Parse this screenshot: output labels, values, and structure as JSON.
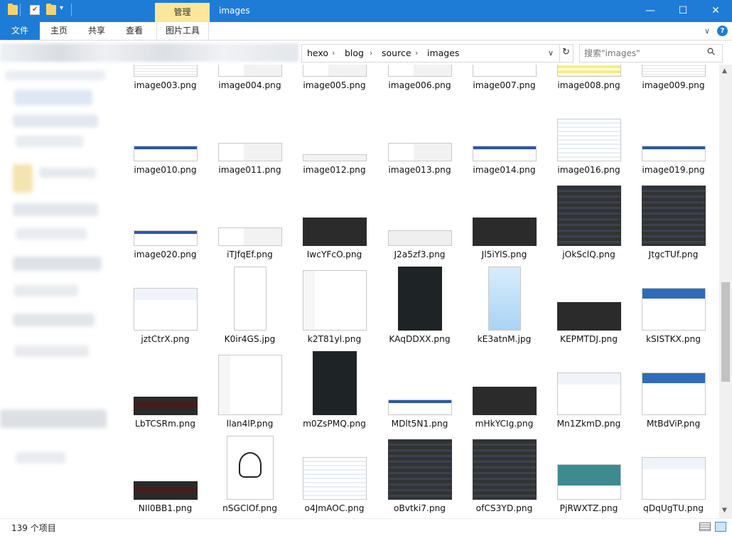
{
  "window": {
    "title": "images",
    "context_tab": "管理",
    "minimize": "—",
    "maximize": "☐",
    "close": "✕"
  },
  "ribbon": {
    "tabs": [
      "文件",
      "主页",
      "共享",
      "查看",
      "图片工具"
    ],
    "expand_icon": "∨",
    "help_icon": "?"
  },
  "address": {
    "crumbs": [
      "hexo",
      "blog",
      "source",
      "images"
    ],
    "dropdown": "∨",
    "refresh": "↻"
  },
  "search": {
    "placeholder": "搜索\"images\"",
    "icon": "⚲"
  },
  "files": [
    {
      "name": "image003.png",
      "kind": "win"
    },
    {
      "name": "image004.png",
      "kind": "tree"
    },
    {
      "name": "image005.png",
      "kind": "tree"
    },
    {
      "name": "image006.png",
      "kind": "tree"
    },
    {
      "name": "image007.png",
      "kind": "winblue"
    },
    {
      "name": "image008.png",
      "kind": "yellow"
    },
    {
      "name": "image009.png",
      "kind": "win"
    },
    {
      "name": "image010.png",
      "kind": "winblue"
    },
    {
      "name": "image011.png",
      "kind": "tree"
    },
    {
      "name": "image012.png",
      "kind": "bar"
    },
    {
      "name": "image013.png",
      "kind": "tree"
    },
    {
      "name": "image014.png",
      "kind": "winblue"
    },
    {
      "name": "image016.png",
      "kind": "table"
    },
    {
      "name": "image019.png",
      "kind": "winblue"
    },
    {
      "name": "image020.png",
      "kind": "winblue"
    },
    {
      "name": "iTJfqEf.png",
      "kind": "tree"
    },
    {
      "name": "IwcYFcO.png",
      "kind": "dark"
    },
    {
      "name": "J2a5zf3.png",
      "kind": "pager"
    },
    {
      "name": "Jl5iYlS.png",
      "kind": "dark"
    },
    {
      "name": "jOkSclQ.png",
      "kind": "darkgrid"
    },
    {
      "name": "JtgcTUf.png",
      "kind": "darkgrid"
    },
    {
      "name": "jztCtrX.png",
      "kind": "web"
    },
    {
      "name": "K0ir4GS.jpg",
      "kind": "phone"
    },
    {
      "name": "k2T81yl.png",
      "kind": "form"
    },
    {
      "name": "KAqDDXX.png",
      "kind": "term"
    },
    {
      "name": "kE3atnM.jpg",
      "kind": "app"
    },
    {
      "name": "KEPMTDJ.png",
      "kind": "dark"
    },
    {
      "name": "kSISTKX.png",
      "kind": "webblue"
    },
    {
      "name": "LbTCSRm.png",
      "kind": "darkred"
    },
    {
      "name": "llan4lP.png",
      "kind": "form"
    },
    {
      "name": "m0ZsPMQ.png",
      "kind": "term"
    },
    {
      "name": "MDlt5N1.png",
      "kind": "winblue"
    },
    {
      "name": "mHkYCIg.png",
      "kind": "dark"
    },
    {
      "name": "Mn1ZkmD.png",
      "kind": "web"
    },
    {
      "name": "MtBdViP.png",
      "kind": "webblue"
    },
    {
      "name": "NIl0BB1.png",
      "kind": "darkred"
    },
    {
      "name": "nSGClOf.png",
      "kind": "avatar"
    },
    {
      "name": "o4JmAOC.png",
      "kind": "table"
    },
    {
      "name": "oBvtki7.png",
      "kind": "darkgrid"
    },
    {
      "name": "ofCS3YD.png",
      "kind": "darkgrid"
    },
    {
      "name": "PjRWXTZ.png",
      "kind": "banner"
    },
    {
      "name": "qDqUgTU.png",
      "kind": "web"
    }
  ],
  "status": {
    "count": "139 个项目"
  },
  "colors": {
    "accent": "#1e7cd7",
    "context_tab": "#fbe79a",
    "folder": "#f7d46a"
  }
}
